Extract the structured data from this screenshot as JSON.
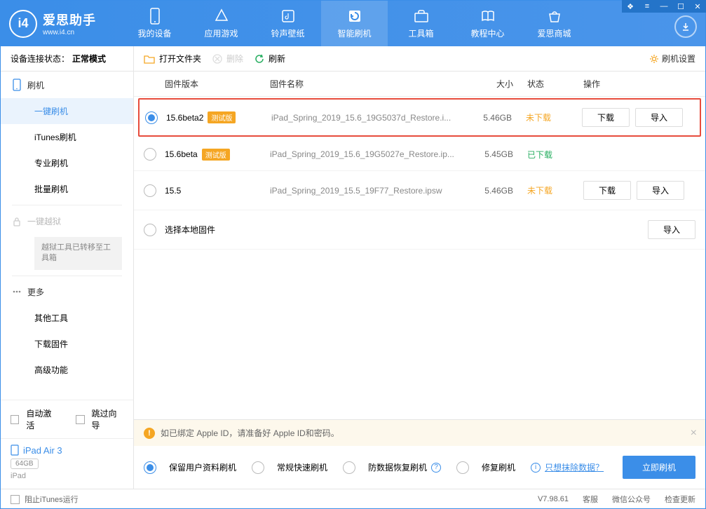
{
  "header": {
    "logo_title": "爱思助手",
    "logo_sub": "www.i4.cn",
    "nav": [
      {
        "label": "我的设备"
      },
      {
        "label": "应用游戏"
      },
      {
        "label": "铃声壁纸"
      },
      {
        "label": "智能刷机"
      },
      {
        "label": "工具箱"
      },
      {
        "label": "教程中心"
      },
      {
        "label": "爱思商城"
      }
    ]
  },
  "sidebar": {
    "status_label": "设备连接状态：",
    "status_value": "正常模式",
    "group_flash": "刷机",
    "items_flash": [
      "一键刷机",
      "iTunes刷机",
      "专业刷机",
      "批量刷机"
    ],
    "group_jailbreak": "一键越狱",
    "jailbreak_note": "越狱工具已转移至工具箱",
    "group_more": "更多",
    "items_more": [
      "其他工具",
      "下载固件",
      "高级功能"
    ],
    "auto_activate": "自动激活",
    "skip_guide": "跳过向导",
    "device_name": "iPad Air 3",
    "device_cap": "64GB",
    "device_type": "iPad"
  },
  "toolbar": {
    "open": "打开文件夹",
    "delete": "删除",
    "refresh": "刷新",
    "settings": "刷机设置"
  },
  "table": {
    "headers": {
      "ver": "固件版本",
      "name": "固件名称",
      "size": "大小",
      "status": "状态",
      "ops": "操作"
    },
    "rows": [
      {
        "ver": "15.6beta2",
        "beta": "测试版",
        "name": "iPad_Spring_2019_15.6_19G5037d_Restore.i...",
        "size": "5.46GB",
        "status": "未下载",
        "status_class": "st-not",
        "download": "下载",
        "import": "导入",
        "checked": true,
        "highlight": true
      },
      {
        "ver": "15.6beta",
        "beta": "测试版",
        "name": "iPad_Spring_2019_15.6_19G5027e_Restore.ip...",
        "size": "5.45GB",
        "status": "已下载",
        "status_class": "st-done",
        "checked": false
      },
      {
        "ver": "15.5",
        "name": "iPad_Spring_2019_15.5_19F77_Restore.ipsw",
        "size": "5.46GB",
        "status": "未下载",
        "status_class": "st-not",
        "download": "下载",
        "import": "导入",
        "checked": false
      },
      {
        "ver": "选择本地固件",
        "import": "导入",
        "checked": false,
        "local": true
      }
    ]
  },
  "bottom": {
    "warn": "如已绑定 Apple ID，请准备好 Apple ID和密码。",
    "modes": [
      "保留用户资料刷机",
      "常规快速刷机",
      "防数据恢复刷机",
      "修复刷机"
    ],
    "erase_link": "只想抹除数据？",
    "flash_btn": "立即刷机"
  },
  "statusbar": {
    "block_itunes": "阻止iTunes运行",
    "version": "V7.98.61",
    "links": [
      "客服",
      "微信公众号",
      "检查更新"
    ]
  }
}
